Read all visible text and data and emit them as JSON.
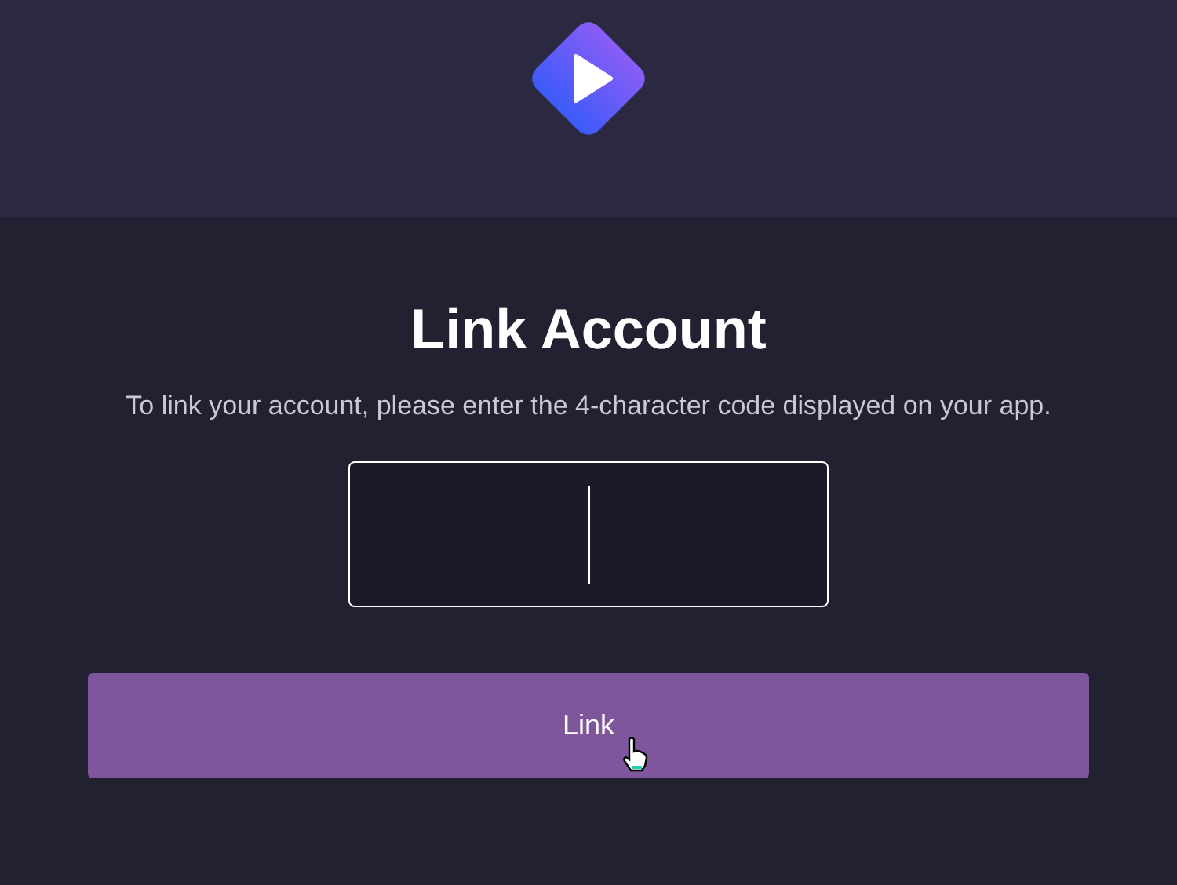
{
  "title": "Link Account",
  "description": "To link your account, please enter the 4-character code displayed on your app.",
  "code_field": {
    "focused": true
  },
  "link_button": {
    "label": "Link",
    "hovered": true
  }
}
